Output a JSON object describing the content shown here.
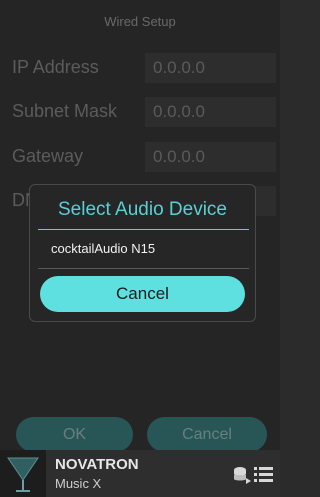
{
  "screen": {
    "title": "Wired Setup",
    "fields": [
      {
        "label": "IP Address",
        "value": "0.0.0.0"
      },
      {
        "label": "Subnet Mask",
        "value": "0.0.0.0"
      },
      {
        "label": "Gateway",
        "value": "0.0.0.0"
      },
      {
        "label": "DNS",
        "value": ""
      }
    ],
    "ok_label": "OK",
    "cancel_label": "Cancel"
  },
  "dialog": {
    "title": "Select Audio Device",
    "devices": [
      "cocktailAudio N15"
    ],
    "cancel_label": "Cancel"
  },
  "now_playing": {
    "title": "NOVATRON",
    "subtitle": "Music X"
  },
  "colors": {
    "accent": "#59d0d6",
    "button_bg": "#5fe0e0"
  },
  "icons": {
    "queue": "queue-icon",
    "menu": "list-menu-icon",
    "album": "album-art-icon"
  }
}
